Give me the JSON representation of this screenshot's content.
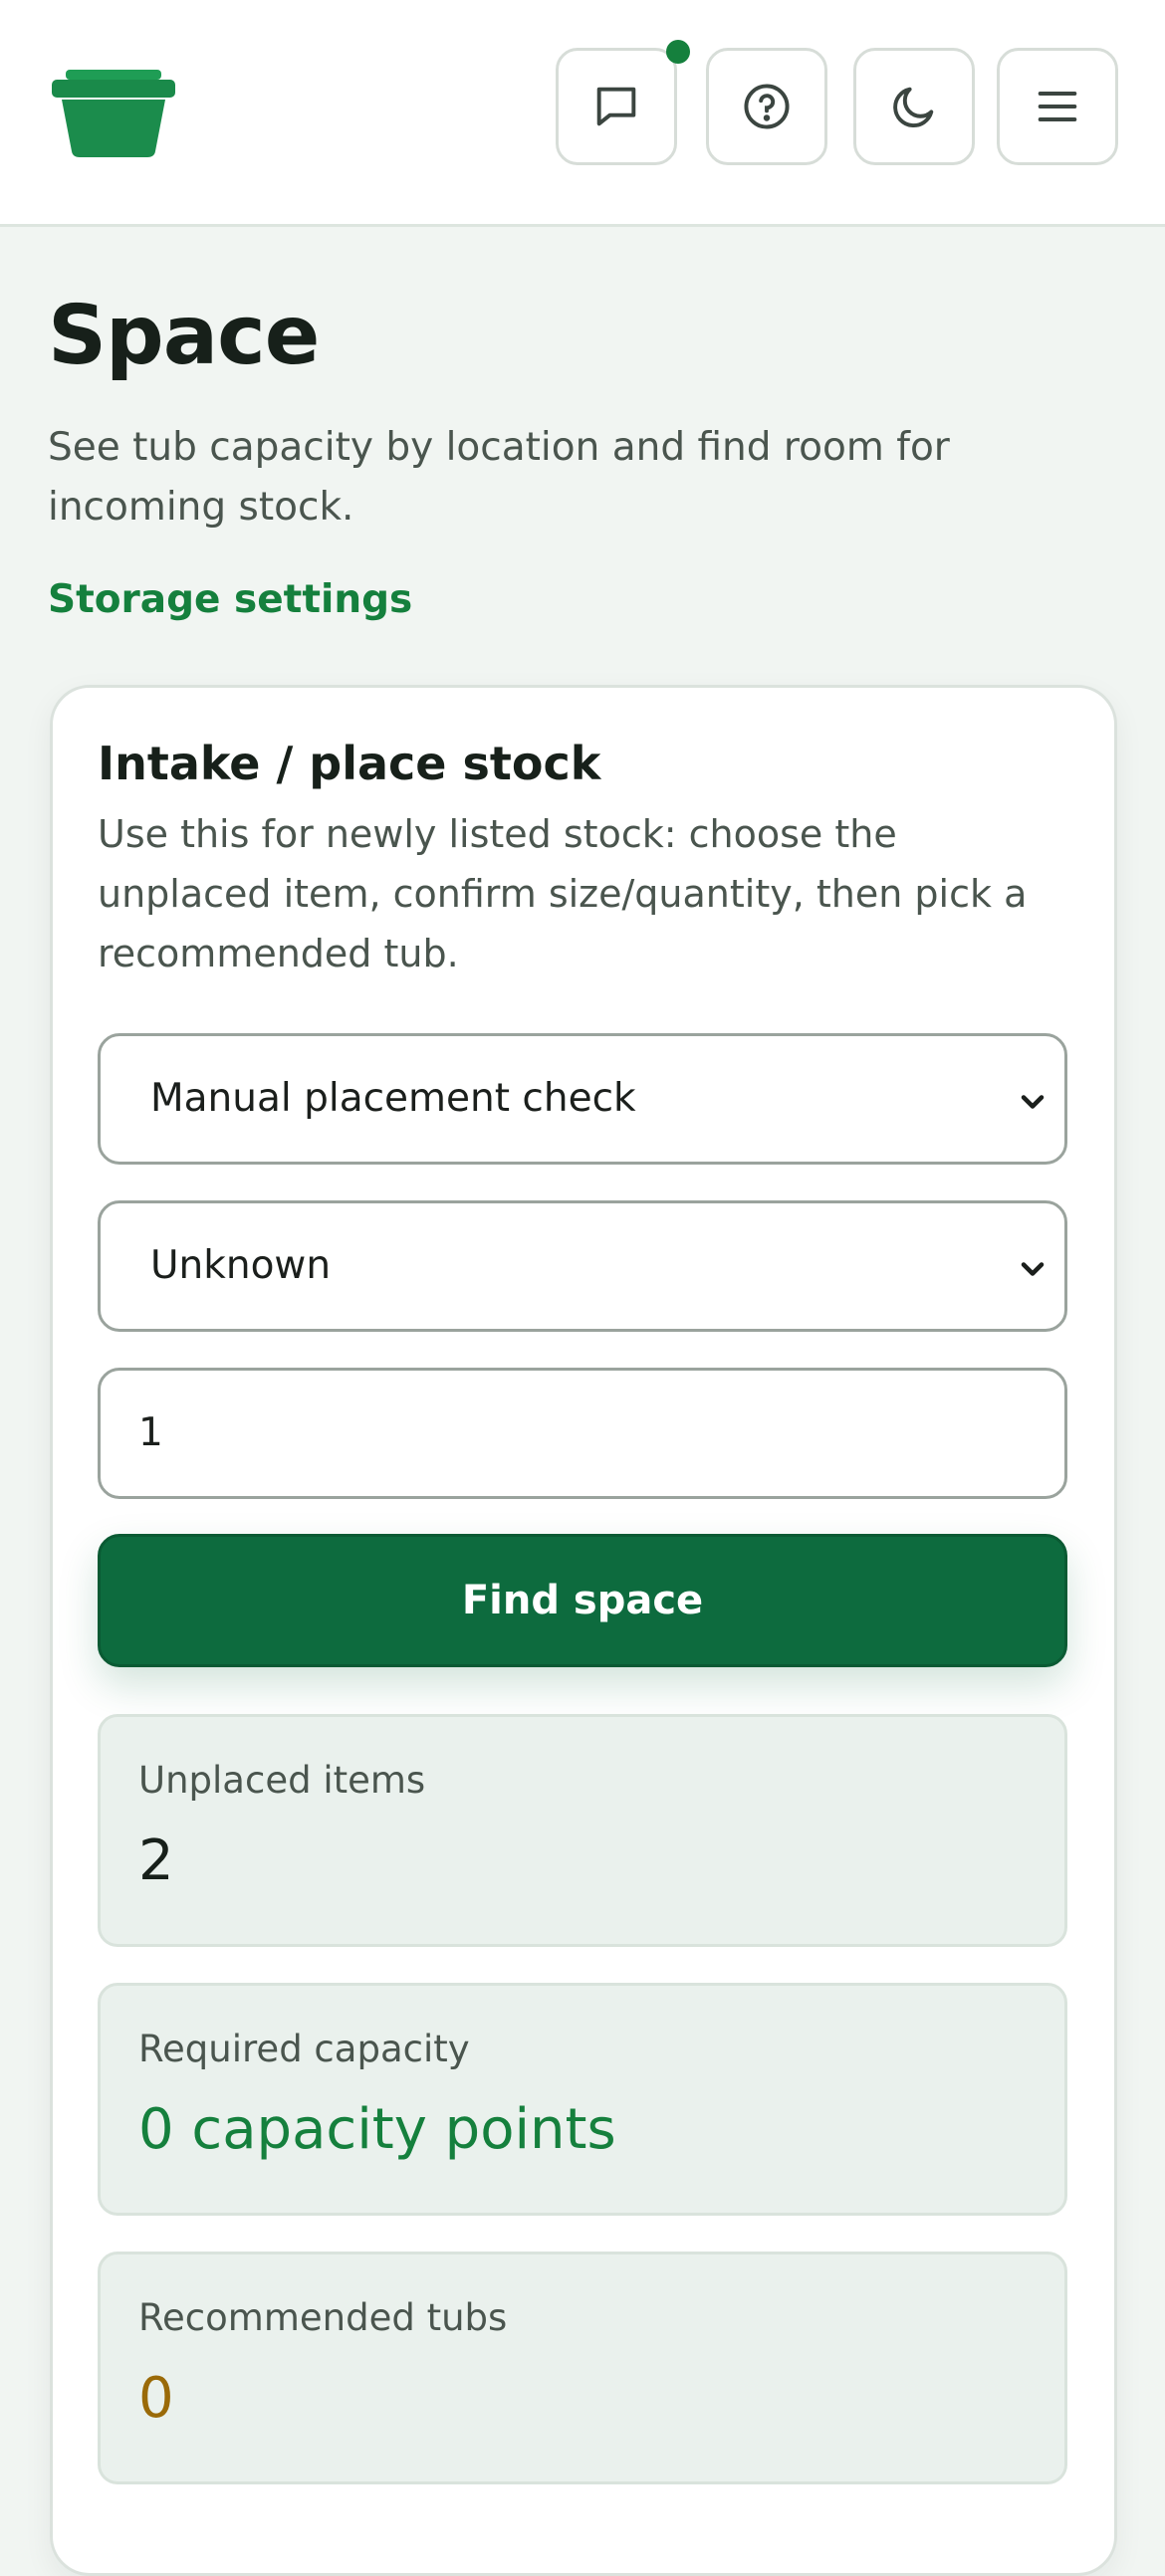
{
  "header": {
    "logo": "tub-logo",
    "buttons": [
      {
        "icon": "message-icon"
      },
      {
        "icon": "help-icon"
      },
      {
        "icon": "moon-icon"
      },
      {
        "icon": "menu-icon"
      }
    ],
    "notification_dot_color": "#15803d"
  },
  "page": {
    "title": "Space",
    "subtitle": "See tub capacity by location and find room for incoming stock.",
    "settings_link": "Storage settings"
  },
  "intake": {
    "title": "Intake / place stock",
    "description": "Use this for newly listed stock: choose the unplaced item, confirm size/quantity, then pick a recommended tub.",
    "item_select_value": "Manual placement check",
    "size_select_value": "Unknown",
    "quantity_value": "1",
    "find_button": "Find space"
  },
  "stats": {
    "unplaced": {
      "label": "Unplaced items",
      "value": "2"
    },
    "required": {
      "label": "Required capacity",
      "value": "0 capacity points"
    },
    "recommended": {
      "label": "Recommended tubs",
      "value": "0"
    }
  },
  "colors": {
    "brand": "#15803d",
    "primary_button": "#0d6b3e",
    "warning": "#9a6a08"
  }
}
